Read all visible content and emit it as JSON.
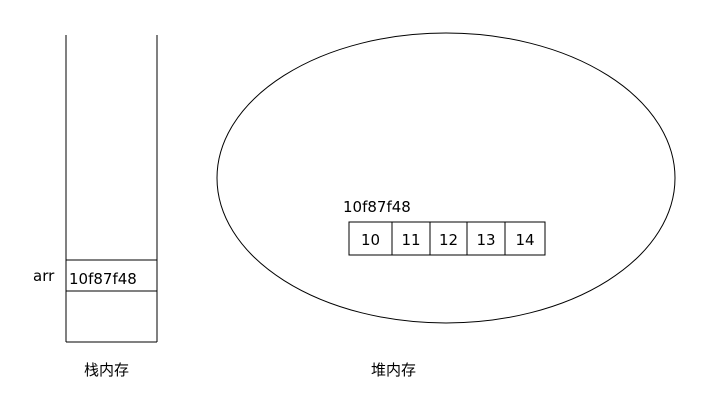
{
  "stack": {
    "variable_name": "arr",
    "cell_value": "10f87f48",
    "caption": "栈内存"
  },
  "heap": {
    "array_address": "10f87f48",
    "elements": [
      "10",
      "11",
      "12",
      "13",
      "14"
    ],
    "caption": "堆内存"
  },
  "colors": {
    "line": "#000000",
    "background": "#ffffff"
  }
}
